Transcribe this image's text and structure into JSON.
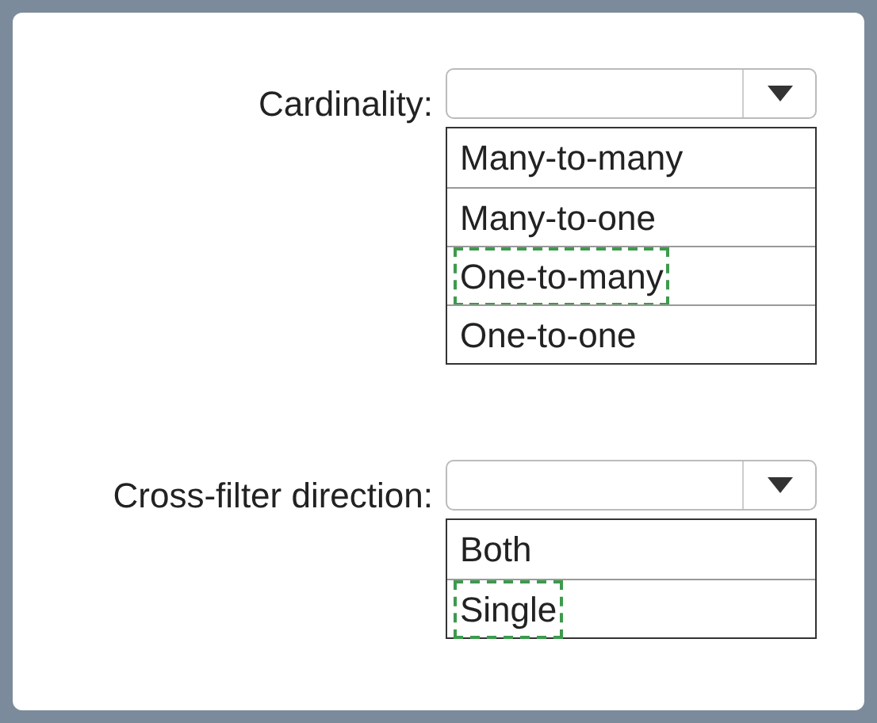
{
  "questions": [
    {
      "label": "Cardinality:",
      "options": [
        {
          "text": "Many-to-many",
          "selected": false
        },
        {
          "text": "Many-to-one",
          "selected": false
        },
        {
          "text": "One-to-many",
          "selected": true
        },
        {
          "text": "One-to-one",
          "selected": false
        }
      ]
    },
    {
      "label": "Cross-filter direction:",
      "options": [
        {
          "text": "Both",
          "selected": false
        },
        {
          "text": "Single",
          "selected": true
        }
      ]
    }
  ]
}
